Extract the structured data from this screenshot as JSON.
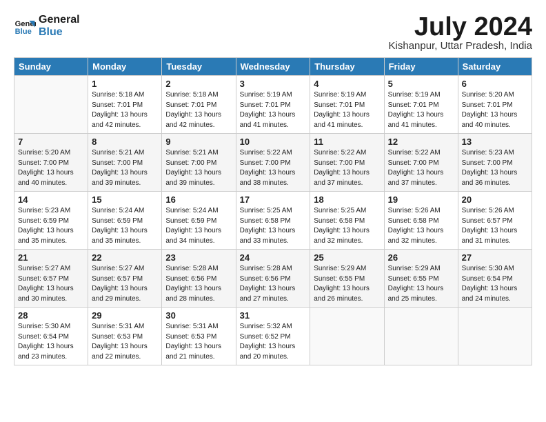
{
  "header": {
    "logo_line1": "General",
    "logo_line2": "Blue",
    "month_year": "July 2024",
    "location": "Kishanpur, Uttar Pradesh, India"
  },
  "days_of_week": [
    "Sunday",
    "Monday",
    "Tuesday",
    "Wednesday",
    "Thursday",
    "Friday",
    "Saturday"
  ],
  "weeks": [
    [
      {
        "day": "",
        "sunrise": "",
        "sunset": "",
        "daylight": ""
      },
      {
        "day": "1",
        "sunrise": "5:18 AM",
        "sunset": "7:01 PM",
        "daylight": "13 hours and 42 minutes."
      },
      {
        "day": "2",
        "sunrise": "5:18 AM",
        "sunset": "7:01 PM",
        "daylight": "13 hours and 42 minutes."
      },
      {
        "day": "3",
        "sunrise": "5:19 AM",
        "sunset": "7:01 PM",
        "daylight": "13 hours and 41 minutes."
      },
      {
        "day": "4",
        "sunrise": "5:19 AM",
        "sunset": "7:01 PM",
        "daylight": "13 hours and 41 minutes."
      },
      {
        "day": "5",
        "sunrise": "5:19 AM",
        "sunset": "7:01 PM",
        "daylight": "13 hours and 41 minutes."
      },
      {
        "day": "6",
        "sunrise": "5:20 AM",
        "sunset": "7:01 PM",
        "daylight": "13 hours and 40 minutes."
      }
    ],
    [
      {
        "day": "7",
        "sunrise": "5:20 AM",
        "sunset": "7:00 PM",
        "daylight": "13 hours and 40 minutes."
      },
      {
        "day": "8",
        "sunrise": "5:21 AM",
        "sunset": "7:00 PM",
        "daylight": "13 hours and 39 minutes."
      },
      {
        "day": "9",
        "sunrise": "5:21 AM",
        "sunset": "7:00 PM",
        "daylight": "13 hours and 39 minutes."
      },
      {
        "day": "10",
        "sunrise": "5:22 AM",
        "sunset": "7:00 PM",
        "daylight": "13 hours and 38 minutes."
      },
      {
        "day": "11",
        "sunrise": "5:22 AM",
        "sunset": "7:00 PM",
        "daylight": "13 hours and 37 minutes."
      },
      {
        "day": "12",
        "sunrise": "5:22 AM",
        "sunset": "7:00 PM",
        "daylight": "13 hours and 37 minutes."
      },
      {
        "day": "13",
        "sunrise": "5:23 AM",
        "sunset": "7:00 PM",
        "daylight": "13 hours and 36 minutes."
      }
    ],
    [
      {
        "day": "14",
        "sunrise": "5:23 AM",
        "sunset": "6:59 PM",
        "daylight": "13 hours and 35 minutes."
      },
      {
        "day": "15",
        "sunrise": "5:24 AM",
        "sunset": "6:59 PM",
        "daylight": "13 hours and 35 minutes."
      },
      {
        "day": "16",
        "sunrise": "5:24 AM",
        "sunset": "6:59 PM",
        "daylight": "13 hours and 34 minutes."
      },
      {
        "day": "17",
        "sunrise": "5:25 AM",
        "sunset": "6:58 PM",
        "daylight": "13 hours and 33 minutes."
      },
      {
        "day": "18",
        "sunrise": "5:25 AM",
        "sunset": "6:58 PM",
        "daylight": "13 hours and 32 minutes."
      },
      {
        "day": "19",
        "sunrise": "5:26 AM",
        "sunset": "6:58 PM",
        "daylight": "13 hours and 32 minutes."
      },
      {
        "day": "20",
        "sunrise": "5:26 AM",
        "sunset": "6:57 PM",
        "daylight": "13 hours and 31 minutes."
      }
    ],
    [
      {
        "day": "21",
        "sunrise": "5:27 AM",
        "sunset": "6:57 PM",
        "daylight": "13 hours and 30 minutes."
      },
      {
        "day": "22",
        "sunrise": "5:27 AM",
        "sunset": "6:57 PM",
        "daylight": "13 hours and 29 minutes."
      },
      {
        "day": "23",
        "sunrise": "5:28 AM",
        "sunset": "6:56 PM",
        "daylight": "13 hours and 28 minutes."
      },
      {
        "day": "24",
        "sunrise": "5:28 AM",
        "sunset": "6:56 PM",
        "daylight": "13 hours and 27 minutes."
      },
      {
        "day": "25",
        "sunrise": "5:29 AM",
        "sunset": "6:55 PM",
        "daylight": "13 hours and 26 minutes."
      },
      {
        "day": "26",
        "sunrise": "5:29 AM",
        "sunset": "6:55 PM",
        "daylight": "13 hours and 25 minutes."
      },
      {
        "day": "27",
        "sunrise": "5:30 AM",
        "sunset": "6:54 PM",
        "daylight": "13 hours and 24 minutes."
      }
    ],
    [
      {
        "day": "28",
        "sunrise": "5:30 AM",
        "sunset": "6:54 PM",
        "daylight": "13 hours and 23 minutes."
      },
      {
        "day": "29",
        "sunrise": "5:31 AM",
        "sunset": "6:53 PM",
        "daylight": "13 hours and 22 minutes."
      },
      {
        "day": "30",
        "sunrise": "5:31 AM",
        "sunset": "6:53 PM",
        "daylight": "13 hours and 21 minutes."
      },
      {
        "day": "31",
        "sunrise": "5:32 AM",
        "sunset": "6:52 PM",
        "daylight": "13 hours and 20 minutes."
      },
      {
        "day": "",
        "sunrise": "",
        "sunset": "",
        "daylight": ""
      },
      {
        "day": "",
        "sunrise": "",
        "sunset": "",
        "daylight": ""
      },
      {
        "day": "",
        "sunrise": "",
        "sunset": "",
        "daylight": ""
      }
    ]
  ]
}
